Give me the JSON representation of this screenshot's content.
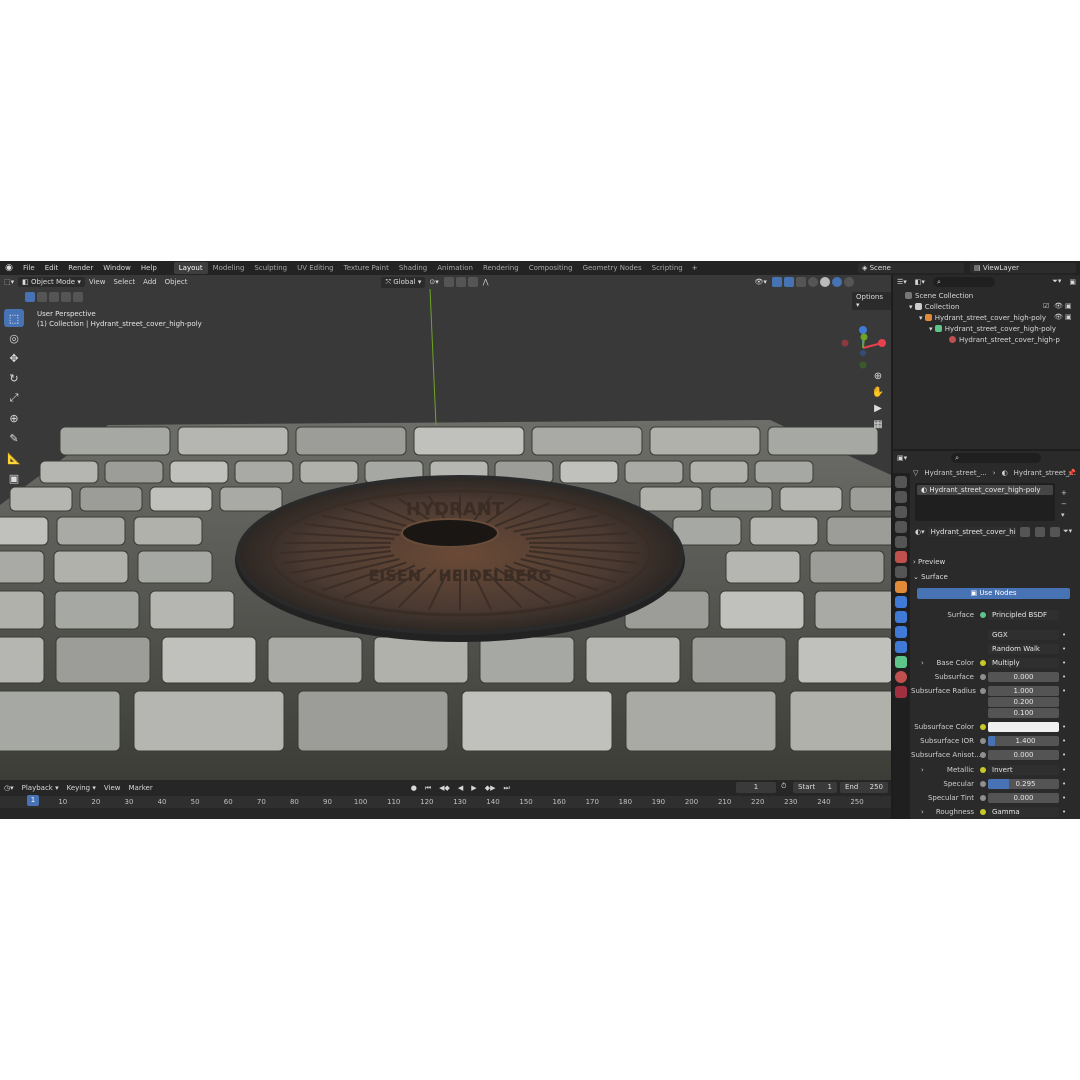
{
  "menu": [
    "File",
    "Edit",
    "Render",
    "Window",
    "Help"
  ],
  "workspaces": [
    {
      "label": "Layout",
      "active": true
    },
    {
      "label": "Modeling"
    },
    {
      "label": "Sculpting"
    },
    {
      "label": "UV Editing"
    },
    {
      "label": "Texture Paint"
    },
    {
      "label": "Shading"
    },
    {
      "label": "Animation"
    },
    {
      "label": "Rendering"
    },
    {
      "label": "Compositing"
    },
    {
      "label": "Geometry Nodes"
    },
    {
      "label": "Scripting"
    }
  ],
  "scene": "Scene",
  "view_layer": "ViewLayer",
  "viewport": {
    "mode": "Object Mode",
    "menus": [
      "View",
      "Select",
      "Add",
      "Object"
    ],
    "transform": "Global",
    "options": "Options",
    "perspective": "User Perspective",
    "collection_line": "(1) Collection | Hydrant_street_cover_high-poly",
    "manhole_text_top": "HYDRANT",
    "manhole_text_bottom": "EISEN · HEIDELBERG"
  },
  "timeline": {
    "menus": [
      "Playback",
      "Keying",
      "View",
      "Marker"
    ],
    "current_frame": "1",
    "start_label": "Start",
    "start": "1",
    "end_label": "End",
    "end": "250",
    "ticks": [
      "1",
      "10",
      "20",
      "30",
      "40",
      "50",
      "60",
      "70",
      "80",
      "90",
      "100",
      "110",
      "120",
      "130",
      "140",
      "150",
      "160",
      "170",
      "180",
      "190",
      "200",
      "210",
      "220",
      "230",
      "240",
      "250"
    ]
  },
  "outliner": {
    "rows": [
      {
        "label": "Scene Collection"
      },
      {
        "label": "Collection"
      },
      {
        "label": "Hydrant_street_cover_high-poly"
      },
      {
        "label": "Hydrant_street_cover_high-poly"
      },
      {
        "label": "Hydrant_street_cover_high-p"
      }
    ]
  },
  "properties": {
    "breadcrumb_left": "Hydrant_street_...",
    "breadcrumb_right": "Hydrant_street_...",
    "slot": "Hydrant_street_cover_high-poly",
    "material_name": "Hydrant_street_cover_high-...",
    "preview": "Preview",
    "surface_section": "Surface",
    "use_nodes": "Use Nodes",
    "surface_label": "Surface",
    "surface_value": "Principled BSDF",
    "distribution": "GGX",
    "subsurface_method": "Random Walk",
    "rows": [
      {
        "label": "Base Color",
        "value": "Multiply",
        "type": "dark"
      },
      {
        "label": "Subsurface",
        "value": "0.000",
        "type": "num"
      },
      {
        "label": "Subsurface Radius",
        "value": "1.000",
        "type": "num"
      },
      {
        "label": "",
        "value": "0.200",
        "type": "num"
      },
      {
        "label": "",
        "value": "0.100",
        "type": "num"
      },
      {
        "label": "Subsurface Color",
        "value": "",
        "type": "white"
      },
      {
        "label": "Subsurface IOR",
        "value": "1.400",
        "type": "bar",
        "fill": 0.1
      },
      {
        "label": "Subsurface Anisot...",
        "value": "0.000",
        "type": "num"
      },
      {
        "label": "Metallic",
        "value": "Invert",
        "type": "dark"
      },
      {
        "label": "Specular",
        "value": "0.295",
        "type": "bar",
        "fill": 0.295
      },
      {
        "label": "Specular Tint",
        "value": "0.000",
        "type": "num"
      },
      {
        "label": "Roughness",
        "value": "Gamma",
        "type": "dark"
      }
    ]
  },
  "colors": {
    "accent": "#4772b3",
    "x_axis": "#e8414d",
    "y_axis": "#6ea328",
    "z_axis": "#3f7bd6"
  }
}
